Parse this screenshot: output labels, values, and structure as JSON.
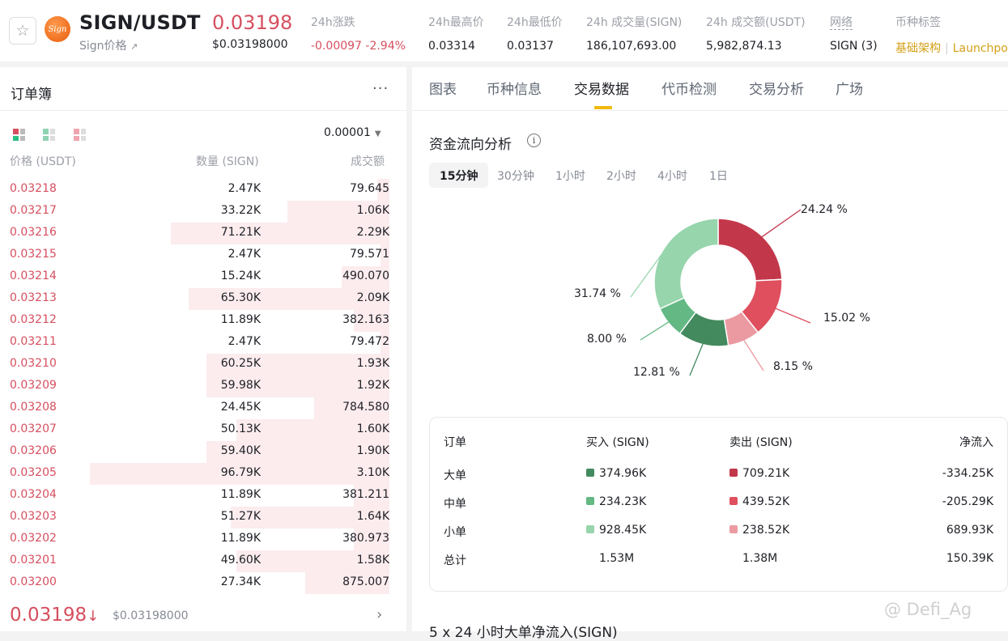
{
  "header": {
    "pair": "SIGN/USDT",
    "subtitle": "Sign价格",
    "subtitle_arrow": "↗",
    "logo_text": "Sign",
    "last_price": "0.03198",
    "last_price_usd": "$0.03198000",
    "stats": [
      {
        "label": "24h涨跌",
        "value": "-0.00097 -2.94%"
      },
      {
        "label": "24h最高价",
        "value": "0.03314"
      },
      {
        "label": "24h最低价",
        "value": "0.03137"
      },
      {
        "label": "24h 成交量(SIGN)",
        "value": "186,107,693.00"
      },
      {
        "label": "24h 成交额(USDT)",
        "value": "5,982,874.13"
      }
    ],
    "network_label": "网络",
    "network_value": "SIGN (3)",
    "tags_label": "币种标签",
    "tags": [
      "基础架构",
      "Launchpool"
    ],
    "icons": {
      "favorite": "star-icon",
      "external": "arrow-up-right-icon"
    }
  },
  "orderbook": {
    "title": "订单簿",
    "more": "···",
    "precision": "0.00001",
    "headers": {
      "price": "价格 (USDT)",
      "qty": "数量 (SIGN)",
      "total": "成交额"
    },
    "rows": [
      {
        "price": "0.03218",
        "qty": "2.47K",
        "total": "79.645",
        "depth": 0.04
      },
      {
        "price": "0.03217",
        "qty": "33.22K",
        "total": "1.06K",
        "depth": 0.34
      },
      {
        "price": "0.03216",
        "qty": "71.21K",
        "total": "2.29K",
        "depth": 0.73
      },
      {
        "price": "0.03215",
        "qty": "2.47K",
        "total": "79.571",
        "depth": 0.03
      },
      {
        "price": "0.03214",
        "qty": "15.24K",
        "total": "490.070",
        "depth": 0.16
      },
      {
        "price": "0.03213",
        "qty": "65.30K",
        "total": "2.09K",
        "depth": 0.67
      },
      {
        "price": "0.03212",
        "qty": "11.89K",
        "total": "382.163",
        "depth": 0.12
      },
      {
        "price": "0.03211",
        "qty": "2.47K",
        "total": "79.472",
        "depth": 0.03
      },
      {
        "price": "0.03210",
        "qty": "60.25K",
        "total": "1.93K",
        "depth": 0.61
      },
      {
        "price": "0.03209",
        "qty": "59.98K",
        "total": "1.92K",
        "depth": 0.61
      },
      {
        "price": "0.03208",
        "qty": "24.45K",
        "total": "784.580",
        "depth": 0.25
      },
      {
        "price": "0.03207",
        "qty": "50.13K",
        "total": "1.60K",
        "depth": 0.51
      },
      {
        "price": "0.03206",
        "qty": "59.40K",
        "total": "1.90K",
        "depth": 0.61
      },
      {
        "price": "0.03205",
        "qty": "96.79K",
        "total": "3.10K",
        "depth": 1.0
      },
      {
        "price": "0.03204",
        "qty": "11.89K",
        "total": "381.211",
        "depth": 0.12
      },
      {
        "price": "0.03203",
        "qty": "51.27K",
        "total": "1.64K",
        "depth": 0.53
      },
      {
        "price": "0.03202",
        "qty": "11.89K",
        "total": "380.973",
        "depth": 0.12
      },
      {
        "price": "0.03201",
        "qty": "49.60K",
        "total": "1.58K",
        "depth": 0.51
      },
      {
        "price": "0.03200",
        "qty": "27.34K",
        "total": "875.007",
        "depth": 0.28
      }
    ],
    "last_price": "0.03198",
    "last_arrow": "↓",
    "last_price_usd": "$0.03198000",
    "chevron": "›"
  },
  "tabs": [
    "图表",
    "币种信息",
    "交易数据",
    "代币检测",
    "交易分析",
    "广场"
  ],
  "active_tab": "交易数据",
  "moneyflow": {
    "title": "资金流向分析",
    "info": "i",
    "timeframes": [
      "15分钟",
      "30分钟",
      "1小时",
      "2小时",
      "4小时",
      "1日"
    ],
    "active_timeframe": "15分钟",
    "chart_data": {
      "type": "pie",
      "donut": true,
      "slices": [
        {
          "label": "24.24 %",
          "value": 24.24,
          "color": "#c3374b"
        },
        {
          "label": "15.02 %",
          "value": 15.02,
          "color": "#df4f5e"
        },
        {
          "label": "8.15 %",
          "value": 8.15,
          "color": "#eb9aa1"
        },
        {
          "label": "12.81 %",
          "value": 12.81,
          "color": "#438a5e"
        },
        {
          "label": "8.00 %",
          "value": 8.0,
          "color": "#63b884"
        },
        {
          "label": "31.74 %",
          "value": 31.74,
          "color": "#97d5ac"
        }
      ]
    },
    "table": {
      "headers": [
        "订单",
        "买入 (SIGN)",
        "卖出 (SIGN)",
        "净流入"
      ],
      "rows": [
        {
          "name": "大单",
          "buy": "374.96K",
          "sell": "709.21K",
          "net": "-334.25K",
          "buy_color": "#438a5e",
          "sell_color": "#c3374b"
        },
        {
          "name": "中单",
          "buy": "234.23K",
          "sell": "439.52K",
          "net": "-205.29K",
          "buy_color": "#63b884",
          "sell_color": "#df4f5e"
        },
        {
          "name": "小单",
          "buy": "928.45K",
          "sell": "238.52K",
          "net": "689.93K",
          "buy_color": "#97d5ac",
          "sell_color": "#eb9aa1"
        },
        {
          "name": "总计",
          "buy": "1.53M",
          "sell": "1.38M",
          "net": "150.39K"
        }
      ]
    },
    "next_heading": "5 x 24 小时大单净流入(SIGN)"
  },
  "watermark": "@ Defi_Ag"
}
